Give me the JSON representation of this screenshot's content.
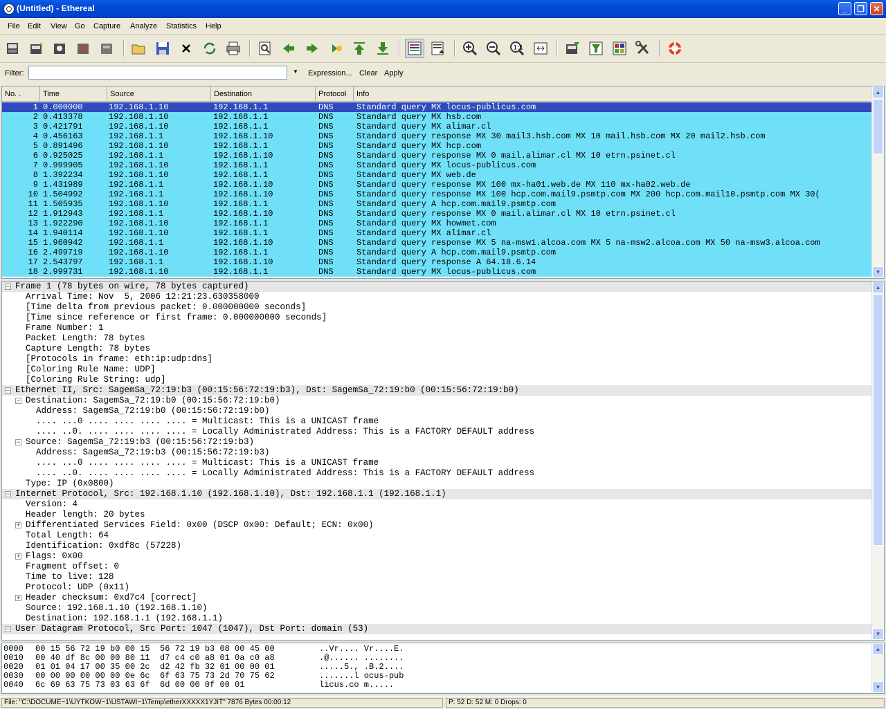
{
  "window": {
    "title": "(Untitled) - Ethereal"
  },
  "menu": [
    "File",
    "Edit",
    "View",
    "Go",
    "Capture",
    "Analyze",
    "Statistics",
    "Help"
  ],
  "toolbar_icons": [
    "interfaces-icon",
    "options-icon",
    "start-icon",
    "stop-icon",
    "restart-icon",
    "open-icon",
    "save-icon",
    "close-icon",
    "reload-icon",
    "print-icon",
    "find-icon",
    "back-icon",
    "forward-icon",
    "goto-icon",
    "first-icon",
    "last-icon",
    "colorize-icon",
    "autoscroll-icon",
    "zoom-in-icon",
    "zoom-out-icon",
    "zoom-normal-icon",
    "resize-icon",
    "capture-filter-icon",
    "display-filter-icon",
    "coloring-icon",
    "preferences-icon",
    "help-icon"
  ],
  "filter": {
    "label": "Filter:",
    "value": "",
    "expression": "Expression...",
    "clear": "Clear",
    "apply": "Apply"
  },
  "columns": [
    "No. .",
    "Time",
    "Source",
    "Destination",
    "Protocol",
    "Info"
  ],
  "packets": [
    [
      "1",
      "0.000000",
      "192.168.1.10",
      "192.168.1.1",
      "DNS",
      "Standard query MX locus-publicus.com"
    ],
    [
      "2",
      "0.413378",
      "192.168.1.10",
      "192.168.1.1",
      "DNS",
      "Standard query MX hsb.com"
    ],
    [
      "3",
      "0.421791",
      "192.168.1.10",
      "192.168.1.1",
      "DNS",
      "Standard query MX alimar.cl"
    ],
    [
      "4",
      "0.456163",
      "192.168.1.1",
      "192.168.1.10",
      "DNS",
      "Standard query response MX 30 mail3.hsb.com MX 10 mail.hsb.com MX 20 mail2.hsb.com"
    ],
    [
      "5",
      "0.891496",
      "192.168.1.10",
      "192.168.1.1",
      "DNS",
      "Standard query MX hcp.com"
    ],
    [
      "6",
      "0.925025",
      "192.168.1.1",
      "192.168.1.10",
      "DNS",
      "Standard query response MX 0 mail.alimar.cl MX 10 etrn.psinet.cl"
    ],
    [
      "7",
      "0.999905",
      "192.168.1.10",
      "192.168.1.1",
      "DNS",
      "Standard query MX locus-publicus.com"
    ],
    [
      "8",
      "1.392234",
      "192.168.1.10",
      "192.168.1.1",
      "DNS",
      "Standard query MX web.de"
    ],
    [
      "9",
      "1.431989",
      "192.168.1.1",
      "192.168.1.10",
      "DNS",
      "Standard query response MX 100 mx-ha01.web.de MX 110 mx-ha02.web.de"
    ],
    [
      "10",
      "1.504992",
      "192.168.1.1",
      "192.168.1.10",
      "DNS",
      "Standard query response MX 100 hcp.com.mail9.psmtp.com MX 200 hcp.com.mail10.psmtp.com MX 30("
    ],
    [
      "11",
      "1.505935",
      "192.168.1.10",
      "192.168.1.1",
      "DNS",
      "Standard query A hcp.com.mail9.psmtp.com"
    ],
    [
      "12",
      "1.912943",
      "192.168.1.1",
      "192.168.1.10",
      "DNS",
      "Standard query response MX 0 mail.alimar.cl MX 10 etrn.psinet.cl"
    ],
    [
      "13",
      "1.922290",
      "192.168.1.10",
      "192.168.1.1",
      "DNS",
      "Standard query MX howmet.com"
    ],
    [
      "14",
      "1.940114",
      "192.168.1.10",
      "192.168.1.1",
      "DNS",
      "Standard query MX alimar.cl"
    ],
    [
      "15",
      "1.960942",
      "192.168.1.1",
      "192.168.1.10",
      "DNS",
      "Standard query response MX 5 na-msw1.alcoa.com MX 5 na-msw2.alcoa.com MX 50 na-msw3.alcoa.com"
    ],
    [
      "16",
      "2.499719",
      "192.168.1.10",
      "192.168.1.1",
      "DNS",
      "Standard query A hcp.com.mail9.psmtp.com"
    ],
    [
      "17",
      "2.543797",
      "192.168.1.1",
      "192.168.1.10",
      "DNS",
      "Standard query response A 64.18.6.14"
    ],
    [
      "18",
      "2.999731",
      "192.168.1.10",
      "192.168.1.1",
      "DNS",
      "Standard query MX locus-publicus.com"
    ]
  ],
  "details": [
    {
      "level": 0,
      "toggle": "-",
      "header": true,
      "text": "Frame 1 (78 bytes on wire, 78 bytes captured)"
    },
    {
      "level": 1,
      "toggle": "",
      "text": "Arrival Time: Nov  5, 2006 12:21:23.630358000"
    },
    {
      "level": 1,
      "toggle": "",
      "text": "[Time delta from previous packet: 0.000000000 seconds]"
    },
    {
      "level": 1,
      "toggle": "",
      "text": "[Time since reference or first frame: 0.000000000 seconds]"
    },
    {
      "level": 1,
      "toggle": "",
      "text": "Frame Number: 1"
    },
    {
      "level": 1,
      "toggle": "",
      "text": "Packet Length: 78 bytes"
    },
    {
      "level": 1,
      "toggle": "",
      "text": "Capture Length: 78 bytes"
    },
    {
      "level": 1,
      "toggle": "",
      "text": "[Protocols in frame: eth:ip:udp:dns]"
    },
    {
      "level": 1,
      "toggle": "",
      "text": "[Coloring Rule Name: UDP]"
    },
    {
      "level": 1,
      "toggle": "",
      "text": "[Coloring Rule String: udp]"
    },
    {
      "level": 0,
      "toggle": "-",
      "header": true,
      "text": "Ethernet II, Src: SagemSa_72:19:b3 (00:15:56:72:19:b3), Dst: SagemSa_72:19:b0 (00:15:56:72:19:b0)"
    },
    {
      "level": 1,
      "toggle": "-",
      "text": "Destination: SagemSa_72:19:b0 (00:15:56:72:19:b0)"
    },
    {
      "level": 2,
      "toggle": "",
      "text": "Address: SagemSa_72:19:b0 (00:15:56:72:19:b0)"
    },
    {
      "level": 2,
      "toggle": "",
      "text": ".... ...0 .... .... .... .... = Multicast: This is a UNICAST frame"
    },
    {
      "level": 2,
      "toggle": "",
      "text": ".... ..0. .... .... .... .... = Locally Administrated Address: This is a FACTORY DEFAULT address"
    },
    {
      "level": 1,
      "toggle": "-",
      "text": "Source: SagemSa_72:19:b3 (00:15:56:72:19:b3)"
    },
    {
      "level": 2,
      "toggle": "",
      "text": "Address: SagemSa_72:19:b3 (00:15:56:72:19:b3)"
    },
    {
      "level": 2,
      "toggle": "",
      "text": ".... ...0 .... .... .... .... = Multicast: This is a UNICAST frame"
    },
    {
      "level": 2,
      "toggle": "",
      "text": ".... ..0. .... .... .... .... = Locally Administrated Address: This is a FACTORY DEFAULT address"
    },
    {
      "level": 1,
      "toggle": "",
      "text": "Type: IP (0x0800)"
    },
    {
      "level": 0,
      "toggle": "-",
      "header": true,
      "text": "Internet Protocol, Src: 192.168.1.10 (192.168.1.10), Dst: 192.168.1.1 (192.168.1.1)"
    },
    {
      "level": 1,
      "toggle": "",
      "text": "Version: 4"
    },
    {
      "level": 1,
      "toggle": "",
      "text": "Header length: 20 bytes"
    },
    {
      "level": 1,
      "toggle": "+",
      "text": "Differentiated Services Field: 0x00 (DSCP 0x00: Default; ECN: 0x00)"
    },
    {
      "level": 1,
      "toggle": "",
      "text": "Total Length: 64"
    },
    {
      "level": 1,
      "toggle": "",
      "text": "Identification: 0xdf8c (57228)"
    },
    {
      "level": 1,
      "toggle": "+",
      "text": "Flags: 0x00"
    },
    {
      "level": 1,
      "toggle": "",
      "text": "Fragment offset: 0"
    },
    {
      "level": 1,
      "toggle": "",
      "text": "Time to live: 128"
    },
    {
      "level": 1,
      "toggle": "",
      "text": "Protocol: UDP (0x11)"
    },
    {
      "level": 1,
      "toggle": "+",
      "text": "Header checksum: 0xd7c4 [correct]"
    },
    {
      "level": 1,
      "toggle": "",
      "text": "Source: 192.168.1.10 (192.168.1.10)"
    },
    {
      "level": 1,
      "toggle": "",
      "text": "Destination: 192.168.1.1 (192.168.1.1)"
    },
    {
      "level": 0,
      "toggle": "-",
      "header": true,
      "text": "User Datagram Protocol, Src Port: 1047 (1047), Dst Port: domain (53)"
    }
  ],
  "hex": [
    {
      "offset": "0000",
      "bytes": "00 15 56 72 19 b0 00 15  56 72 19 b3 08 00 45 00",
      "ascii": "..Vr.... Vr....E."
    },
    {
      "offset": "0010",
      "bytes": "00 40 df 8c 00 00 80 11  d7 c4 c0 a8 01 0a c0 a8",
      "ascii": ".@...... ........"
    },
    {
      "offset": "0020",
      "bytes": "01 01 04 17 00 35 00 2c  d2 42 fb 32 01 00 00 01",
      "ascii": ".....5., .B.2...."
    },
    {
      "offset": "0030",
      "bytes": "00 00 00 00 00 00 0e 6c  6f 63 75 73 2d 70 75 62",
      "ascii": ".......l ocus-pub"
    },
    {
      "offset": "0040",
      "bytes": "6c 69 63 75 73 03 63 6f  6d 00 00 0f 00 01",
      "ascii": "licus.co m....."
    }
  ],
  "status": {
    "file": "File: \"C:\\DOCUME~1\\UYTKOW~1\\USTAWI~1\\Temp\\etherXXXXX1YJIT\" 7876 Bytes 00:00:12",
    "counts": "P: 52 D: 52 M: 0 Drops: 0"
  }
}
